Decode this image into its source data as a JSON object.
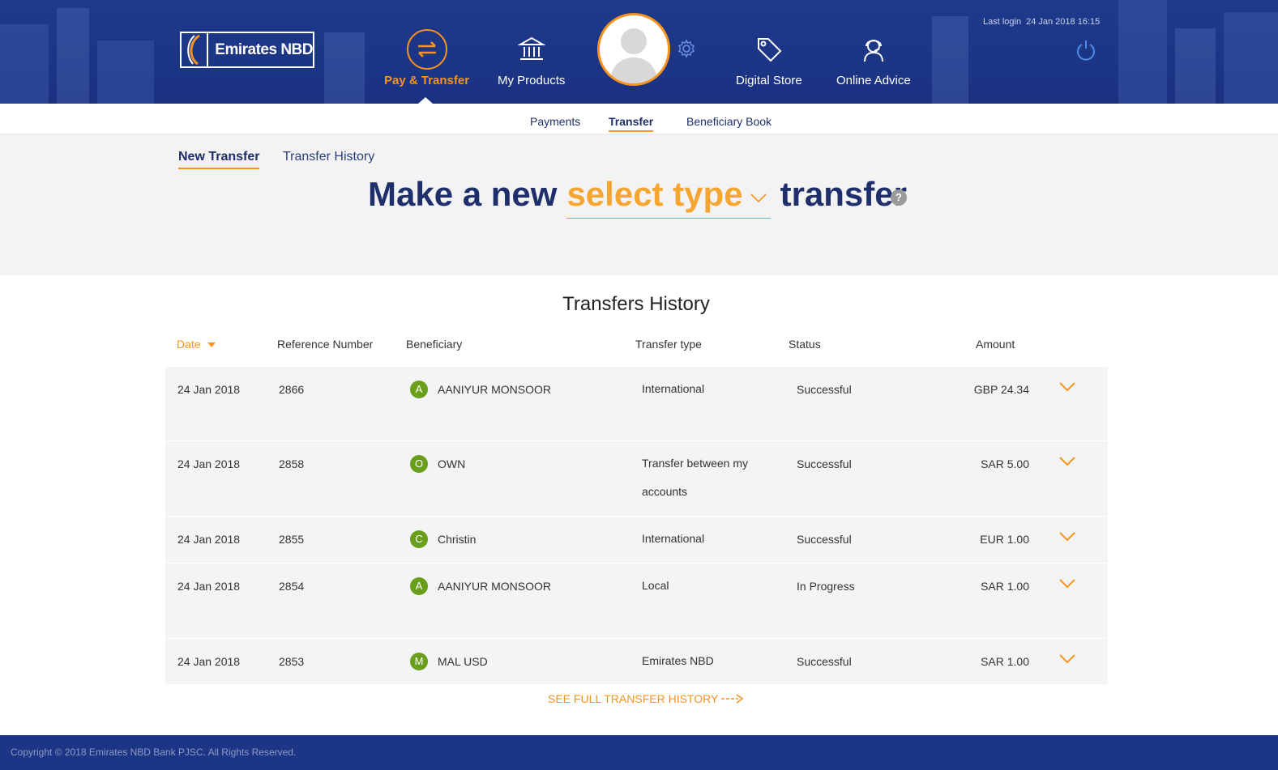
{
  "brand": {
    "name": "Emirates NBD"
  },
  "header": {
    "nav": [
      {
        "label": "Pay & Transfer",
        "icon": "transfer-arrows-icon",
        "active": true
      },
      {
        "label": "My Products",
        "icon": "bank-building-icon",
        "active": false
      },
      {
        "label": "Digital Store",
        "icon": "price-tag-icon",
        "active": false
      },
      {
        "label": "Online Advice",
        "icon": "headset-advisor-icon",
        "active": false
      }
    ],
    "last_login_label": "Last login",
    "last_login_value": "24 Jan 2018 16:15"
  },
  "subnav": {
    "items": [
      {
        "label": "Payments",
        "active": false
      },
      {
        "label": "Transfer",
        "active": true
      },
      {
        "label": "Beneficiary Book",
        "active": false
      }
    ]
  },
  "panel": {
    "tabs": [
      {
        "label": "New Transfer",
        "active": true
      },
      {
        "label": "Transfer History",
        "active": false
      }
    ],
    "headline_prefix": "Make a new",
    "headline_select": "select type",
    "headline_suffix": "transfer",
    "help": "?"
  },
  "history": {
    "title": "Transfers History",
    "columns": {
      "date": "Date",
      "reference": "Reference Number",
      "beneficiary": "Beneficiary",
      "type": "Transfer type",
      "status": "Status",
      "amount": "Amount"
    },
    "rows": [
      {
        "date": "24 Jan 2018",
        "reference": "2866",
        "initial": "A",
        "beneficiary": "AANIYUR MONSOOR",
        "type": "International",
        "status": "Successful",
        "amount": "GBP 24.34"
      },
      {
        "date": "24 Jan 2018",
        "reference": "2858",
        "initial": "O",
        "beneficiary": "OWN",
        "type": "Transfer between my accounts",
        "status": "Successful",
        "amount": "SAR 5.00"
      },
      {
        "date": "24 Jan 2018",
        "reference": "2855",
        "initial": "C",
        "beneficiary": "Christin",
        "type": "International",
        "status": "Successful",
        "amount": "EUR 1.00"
      },
      {
        "date": "24 Jan 2018",
        "reference": "2854",
        "initial": "A",
        "beneficiary": "AANIYUR MONSOOR",
        "type": "Local",
        "status": "In Progress",
        "amount": "SAR 1.00"
      },
      {
        "date": "24 Jan 2018",
        "reference": "2853",
        "initial": "M",
        "beneficiary": "MAL USD",
        "type": "Emirates NBD",
        "status": "Successful",
        "amount": "SAR 1.00"
      }
    ],
    "see_full": "SEE FULL TRANSFER HISTORY"
  },
  "footer": {
    "copyright": "Copyright © 2018 Emirates NBD Bank PJSC. All Rights Reserved."
  },
  "colors": {
    "brand_blue": "#1c3585",
    "accent_orange": "#f7931e",
    "initial_green": "#6a9f1c"
  }
}
